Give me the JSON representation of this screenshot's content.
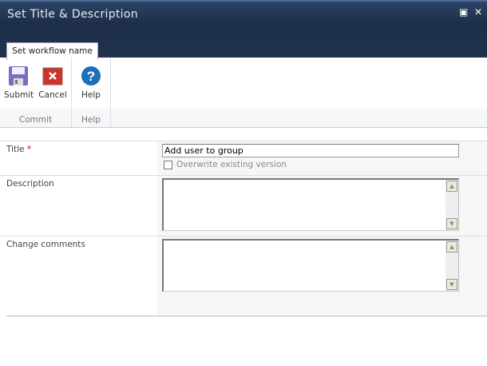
{
  "dialog": {
    "title": "Set Title & Description",
    "maximize_icon": "maximize-icon",
    "close_icon": "close-icon"
  },
  "ribbon": {
    "tab": "Set workflow name",
    "groups": [
      {
        "label": "Commit",
        "buttons": [
          {
            "label": "Submit",
            "icon": "save-icon"
          },
          {
            "label": "Cancel",
            "icon": "cancel-icon"
          }
        ]
      },
      {
        "label": "Help",
        "buttons": [
          {
            "label": "Help",
            "icon": "help-icon"
          }
        ]
      }
    ]
  },
  "form": {
    "title_label": "Title",
    "required_mark": "*",
    "title_value": "Add user to group",
    "overwrite_label": "Overwrite existing version",
    "overwrite_checked": false,
    "description_label": "Description",
    "description_value": "",
    "comments_label": "Change comments",
    "comments_value": ""
  },
  "colors": {
    "header": "#1d2e48",
    "required": "#cc0000"
  }
}
